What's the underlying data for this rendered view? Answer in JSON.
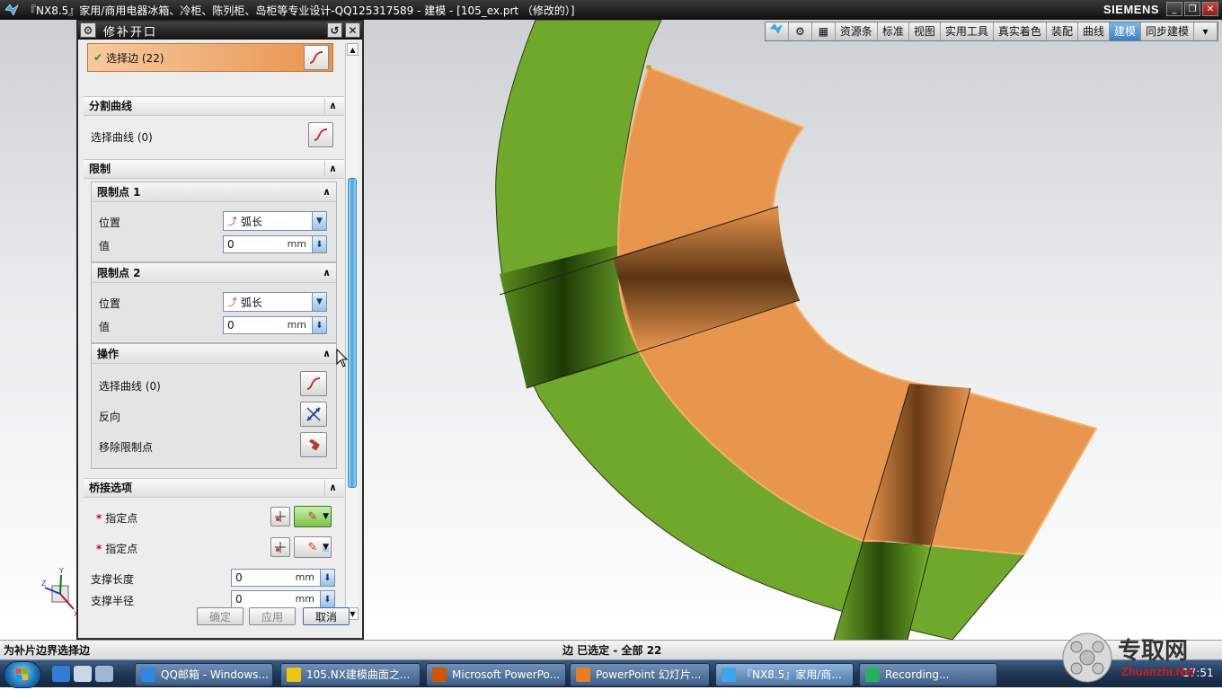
{
  "window": {
    "title": "『NX8.5』家用/商用电器冰箱、冷柜、陈列柜、岛柜等专业设计-QQ125317589 - 建模 - [105_ex.prt （修改的）]",
    "brand": "SIEMENS"
  },
  "ribbon": {
    "tabs": [
      "资源条",
      "标准",
      "视图",
      "实用工具",
      "真实着色",
      "装配",
      "曲线",
      "建模",
      "同步建模"
    ],
    "active_tab": "建模"
  },
  "dialog": {
    "title": "修补开口",
    "select_edge_label": "选择边 (22)",
    "split_curve": {
      "header": "分割曲线",
      "select_curve_label": "选择曲线 (0)"
    },
    "limits": {
      "header": "限制",
      "limit1": {
        "header": "限制点 1",
        "position_label": "位置",
        "position_value": "弧长",
        "value_label": "值",
        "value": "0",
        "unit": "mm"
      },
      "limit2": {
        "header": "限制点 2",
        "position_label": "位置",
        "position_value": "弧长",
        "value_label": "值",
        "value": "0",
        "unit": "mm"
      },
      "operation": {
        "header": "操作",
        "select_curve_label": "选择曲线 (0)",
        "reverse_label": "反向",
        "remove_limit_label": "移除限制点"
      }
    },
    "bridge": {
      "header": "桥接选项",
      "specify_point_1": "指定点",
      "specify_point_2": "指定点",
      "support_length_label": "支撑长度",
      "support_length_value": "0",
      "support_radius_label": "支撑半径",
      "support_radius_value": "0",
      "unit": "mm"
    },
    "buttons": {
      "ok": "确定",
      "apply": "应用",
      "cancel": "取消"
    }
  },
  "status": {
    "left": "为补片边界选择边",
    "center": "边 已选定 - 全部 22"
  },
  "taskbar": {
    "items": [
      "QQ邮箱 - Windows...",
      "105.NX建模曲面之...",
      "Microsoft PowerPo...",
      "PowerPoint 幻灯片...",
      "『NX8.5』家用/商...",
      "Recording..."
    ],
    "clock": "17:51"
  },
  "watermark": {
    "text": "专取网",
    "url": "Zhuanzhi.Net"
  },
  "colors": {
    "selected_face": "#e8964e",
    "green_face": "#6fa82a",
    "accent_blue": "#3b7fc2"
  }
}
